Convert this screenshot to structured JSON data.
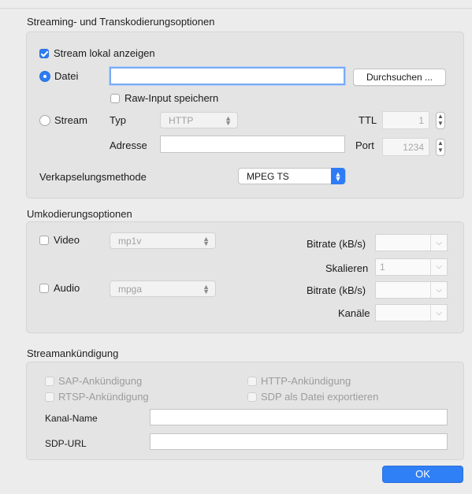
{
  "streaming": {
    "title": "Streaming- und Transkodierungsoptionen",
    "show_local_label": "Stream lokal anzeigen",
    "datei_label": "Datei",
    "datei_value": "",
    "browse_label": "Durchsuchen ...",
    "raw_input_label": "Raw-Input speichern",
    "stream_label": "Stream",
    "typ_label": "Typ",
    "typ_value": "HTTP",
    "ttl_label": "TTL",
    "ttl_value": "1",
    "adresse_label": "Adresse",
    "adresse_value": "",
    "port_label": "Port",
    "port_value": "1234",
    "encapsulation_label": "Verkapselungsmethode",
    "encapsulation_value": "MPEG TS"
  },
  "transcoding": {
    "title": "Umkodierungsoptionen",
    "video_label": "Video",
    "video_codec": "mp1v",
    "video_bitrate_label": "Bitrate (kB/s)",
    "video_bitrate_value": "",
    "scale_label": "Skalieren",
    "scale_value": "1",
    "audio_label": "Audio",
    "audio_codec": "mpga",
    "audio_bitrate_label": "Bitrate (kB/s)",
    "audio_bitrate_value": "",
    "channels_label": "Kanäle",
    "channels_value": ""
  },
  "announcement": {
    "title": "Streamankündigung",
    "sap_label": "SAP-Ankündigung",
    "http_label": "HTTP-Ankündigung",
    "rtsp_label": "RTSP-Ankündigung",
    "sdp_export_label": "SDP als Datei exportieren",
    "channel_name_label": "Kanal-Name",
    "channel_name_value": "",
    "sdp_url_label": "SDP-URL",
    "sdp_url_value": ""
  },
  "ok_label": "OK"
}
